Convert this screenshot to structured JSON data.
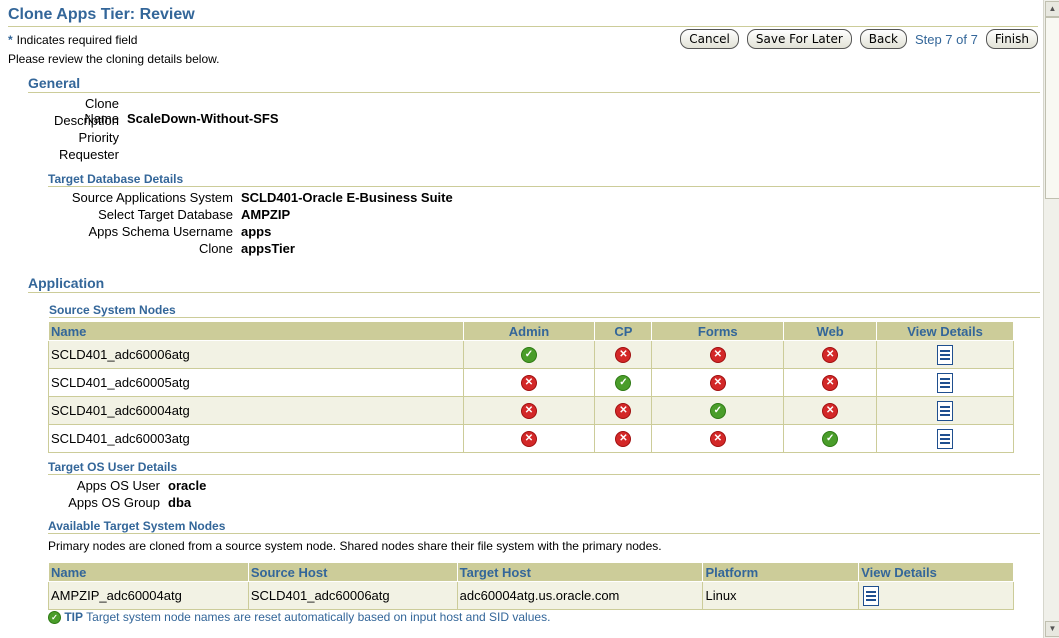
{
  "page": {
    "title": "Clone Apps Tier: Review",
    "required_note": "Indicates required field",
    "required_star": "*",
    "instruction": "Please review the cloning details below."
  },
  "buttons": {
    "cancel": "Cancel",
    "save_for_later": "Save For Later",
    "back": "Back",
    "step": "Step 7 of 7",
    "finish": "Finish"
  },
  "general": {
    "heading": "General",
    "fields": [
      {
        "label": "Clone Name",
        "value": "ScaleDown-Without-SFS"
      },
      {
        "label": "Description",
        "value": ""
      },
      {
        "label": "Priority",
        "value": ""
      },
      {
        "label": "Requester",
        "value": ""
      }
    ],
    "target_db": {
      "heading": "Target Database Details",
      "fields": [
        {
          "label": "Source Applications System",
          "value": "SCLD401-Oracle E-Business Suite"
        },
        {
          "label": "Select Target Database",
          "value": "AMPZIP"
        },
        {
          "label": "Apps Schema Username",
          "value": "apps"
        },
        {
          "label": "Clone",
          "value": "appsTier"
        }
      ]
    }
  },
  "application": {
    "heading": "Application",
    "source_nodes": {
      "heading": "Source System Nodes",
      "columns": [
        "Name",
        "Admin",
        "CP",
        "Forms",
        "Web",
        "View Details"
      ],
      "rows": [
        {
          "name": "SCLD401_adc60006atg",
          "admin": true,
          "cp": false,
          "forms": false,
          "web": false
        },
        {
          "name": "SCLD401_adc60005atg",
          "admin": false,
          "cp": true,
          "forms": false,
          "web": false
        },
        {
          "name": "SCLD401_adc60004atg",
          "admin": false,
          "cp": false,
          "forms": true,
          "web": false
        },
        {
          "name": "SCLD401_adc60003atg",
          "admin": false,
          "cp": false,
          "forms": false,
          "web": true
        }
      ]
    },
    "os_user": {
      "heading": "Target OS User Details",
      "fields": [
        {
          "label": "Apps OS User",
          "value": "oracle"
        },
        {
          "label": "Apps OS Group",
          "value": "dba"
        }
      ]
    },
    "target_nodes": {
      "heading": "Available Target System Nodes",
      "note": "Primary nodes are cloned from a source system node. Shared nodes share their file system with the primary nodes.",
      "columns": [
        "Name",
        "Source Host",
        "Target Host",
        "Platform",
        "View Details"
      ],
      "rows": [
        {
          "name": "AMPZIP_adc60004atg",
          "source_host": "SCLD401_adc60006atg",
          "target_host": "adc60004atg.us.oracle.com",
          "platform": "Linux"
        }
      ]
    },
    "tip": {
      "label": "TIP",
      "text": "Target system node names are reset automatically based on input host and SID values."
    }
  },
  "colors": {
    "accent": "#336699",
    "header_bg": "#cccc99",
    "ok": "#4a9d2a",
    "error": "#d32828"
  }
}
